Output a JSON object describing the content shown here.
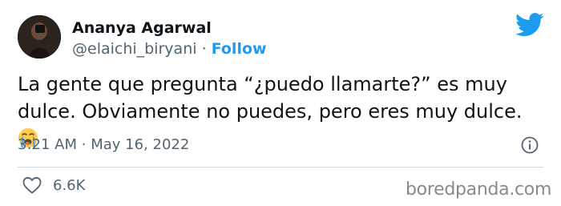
{
  "tweet": {
    "author_name": "Ananya Agarwal",
    "handle": "@elaichi_biryani",
    "separator": "·",
    "follow_label": "Follow",
    "text": "La gente que pregunta “¿puedo llamarte?” es muy dulce. Obviamente no puedes, pero eres muy dulce.",
    "emoji": "loudly-crying-face",
    "time": "3:21 AM",
    "date": "May 16, 2022",
    "like_count": "6.6K"
  },
  "watermark": "boredpanda.com",
  "icons": {
    "brand": "twitter-bird-icon",
    "info": "info-icon",
    "like": "heart-icon"
  },
  "colors": {
    "twitter_blue": "#1d9bf0",
    "text": "#0f1419",
    "secondary": "#536471",
    "divider": "#cfd9de",
    "watermark": "#8a8a8a"
  }
}
